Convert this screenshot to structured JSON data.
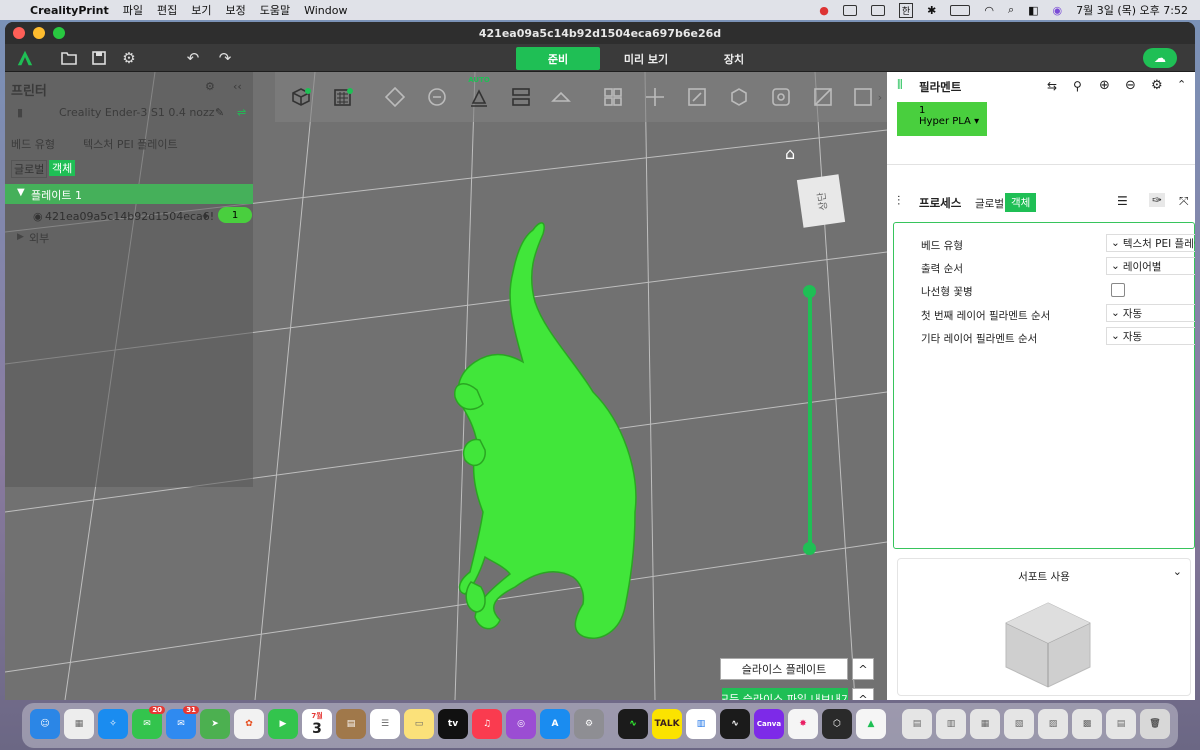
{
  "menubar": {
    "app_name": "CrealityPrint",
    "menus": [
      "파일",
      "편집",
      "보기",
      "보정",
      "도움말",
      "Window"
    ],
    "datetime": "7월 3일 (목) 오후 7:52",
    "input_method": "한"
  },
  "window": {
    "title": "421ea09a5c14b92d1504eca697b6e26d"
  },
  "toolbar": {
    "tabs": [
      {
        "label": "준비",
        "active": true
      },
      {
        "label": "미리 보기",
        "active": false
      },
      {
        "label": "장치",
        "active": false
      }
    ]
  },
  "left_panel": {
    "section_title": "프린터",
    "printer_name": "Creality Ender-3 S1 0.4 nozz",
    "bed_type_label": "베드 유형",
    "bed_type_value": "텍스처 PEI 플레이트",
    "mode_global": "글로벌",
    "mode_object": "객체",
    "plate_label": "플레이트 1",
    "object_name": "421ea09a5c14b92d1504eca6!",
    "object_badge": "1",
    "outside_label": "외부"
  },
  "viewport": {
    "auto_label": "AUTO",
    "view_cube_label": "상단",
    "model_color": "#41e63a",
    "accent_color": "#1fbf55"
  },
  "slice": {
    "slice_plate": "슬라이스 플레이트",
    "export_all": "모든 슬라이스 파일 내보내기",
    "caret": "^"
  },
  "right_panel": {
    "filament_title": "필라멘트",
    "filament_slot": "1",
    "filament_name": "Hyper PLA",
    "process_title": "프로세스",
    "tab_global": "글로벌",
    "tab_object": "객체",
    "properties": [
      {
        "label": "베드 유형",
        "value": "텍스처 PEI 플레이"
      },
      {
        "label": "출력 순서",
        "value": "레이어별"
      },
      {
        "label": "나선형 꽃병",
        "value": ""
      },
      {
        "label": "첫 번째 레이어 필라멘트 순서",
        "value": "자동"
      },
      {
        "label": "기타 레이어 필라멘트 순서",
        "value": "자동"
      }
    ],
    "support_title": "서포트 사용"
  },
  "dock": {
    "badges": {
      "messages": "20",
      "mail": "31"
    },
    "calendar_day": "3",
    "calendar_month": "7월"
  }
}
